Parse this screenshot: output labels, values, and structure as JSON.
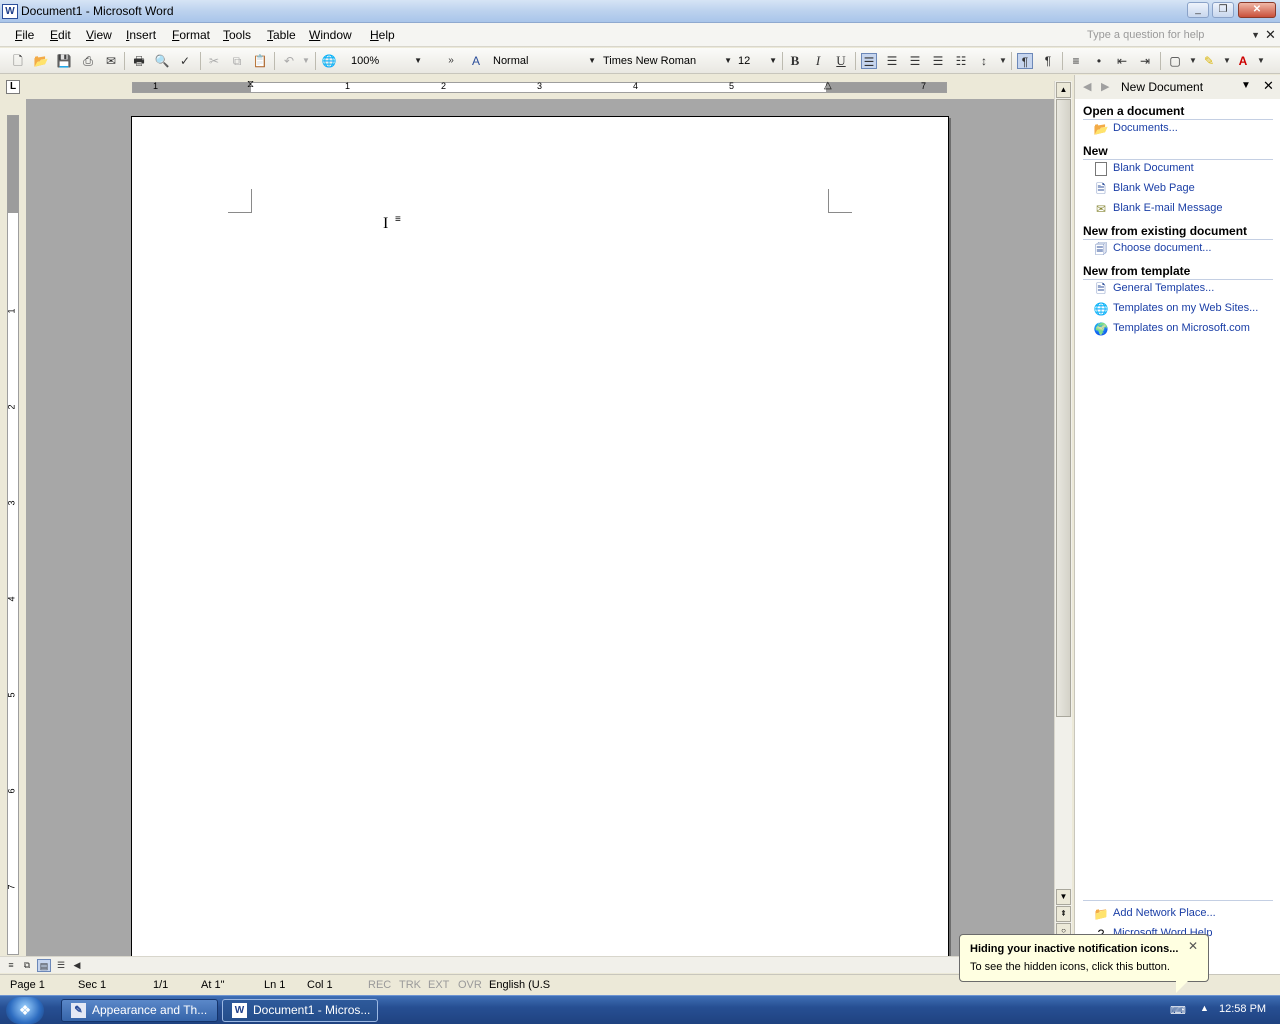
{
  "window": {
    "title": "Document1 - Microsoft Word",
    "app_icon": "W"
  },
  "menu": {
    "items": [
      {
        "label": "File",
        "ul": "F",
        "rest": "ile"
      },
      {
        "label": "Edit",
        "ul": "E",
        "rest": "dit"
      },
      {
        "label": "View",
        "ul": "V",
        "rest": "iew"
      },
      {
        "label": "Insert",
        "ul": "I",
        "rest": "nsert"
      },
      {
        "label": "Format",
        "ul": "F",
        "rest": "ormat"
      },
      {
        "label": "Tools",
        "ul": "T",
        "rest": "ools"
      },
      {
        "label": "Table",
        "ul": "T",
        "rest": "able"
      },
      {
        "label": "Window",
        "ul": "W",
        "rest": "indow"
      },
      {
        "label": "Help",
        "ul": "H",
        "rest": "elp"
      }
    ],
    "help_placeholder": "Type a question for help"
  },
  "toolbar": {
    "zoom": "100%",
    "style": "Normal",
    "font": "Times New Roman",
    "size": "12",
    "bold": "B",
    "italic": "I",
    "underline": "U"
  },
  "ruler": {
    "h_numbers": [
      "1",
      "1",
      "2",
      "3",
      "4",
      "5",
      "7"
    ],
    "v_numbers": [
      "1",
      "2",
      "3",
      "4",
      "5",
      "6",
      "7"
    ]
  },
  "taskpane": {
    "title": "New Document",
    "sections": {
      "open": "Open a document",
      "new": "New",
      "existing": "New from existing document",
      "template": "New from template"
    },
    "links": {
      "documents": "Documents...",
      "blank_doc": "Blank Document",
      "blank_web": "Blank Web Page",
      "blank_email": "Blank E-mail Message",
      "choose_doc": "Choose document...",
      "general_templates": "General Templates...",
      "web_sites_templates": "Templates on my Web Sites...",
      "ms_templates": "Templates on Microsoft.com",
      "add_network": "Add Network Place...",
      "word_help": "Microsoft Word Help"
    }
  },
  "statusbar": {
    "page": "Page  1",
    "sec": "Sec  1",
    "pages": "1/1",
    "at": "At  1\"",
    "ln": "Ln  1",
    "col": "Col  1",
    "rec": "REC",
    "trk": "TRK",
    "ext": "EXT",
    "ovr": "OVR",
    "lang": "English (U.S"
  },
  "balloon": {
    "title": "Hiding your inactive notification icons...",
    "text": "To see the hidden icons, click this button."
  },
  "taskbar": {
    "tasks": [
      "Appearance and Th...",
      "Document1 - Micros..."
    ],
    "clock": "12:58 PM"
  },
  "colors": {
    "accent": "#1a3ea6",
    "page_bg": "#a7a7a7",
    "balloon_bg": "#ffffe1"
  }
}
